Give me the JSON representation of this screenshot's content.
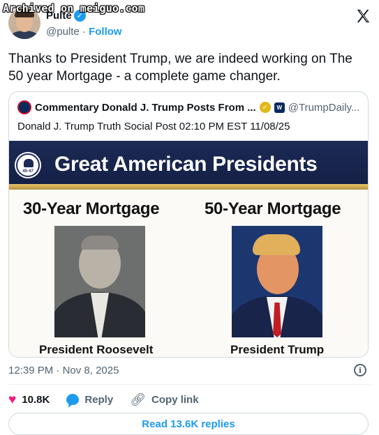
{
  "watermark": "Archived on meiguo.com",
  "author": {
    "name": "Pulte",
    "handle": "@pulte",
    "follow_label": "Follow"
  },
  "tweet_text": "Thanks to President Trump, we are indeed working on The 50 year Mortgage  - a complete game changer.",
  "quote": {
    "name": "Commentary Donald J. Trump Posts From ...",
    "handle": "@TrumpDaily...",
    "affiliate_badge": "W",
    "subtitle": "Donald J. Trump Truth Social Post 02:10 PM EST 11/08/25",
    "image": {
      "seal_text": "45·47",
      "banner_title": "Great American Presidents",
      "left_heading": "30-Year Mortgage",
      "right_heading": "50-Year Mortgage",
      "left_name": "President Roosevelt",
      "right_name": "President Trump"
    }
  },
  "meta": {
    "time": "12:39 PM",
    "separator": " · ",
    "date": "Nov 8, 2025"
  },
  "actions": {
    "likes": "10.8K",
    "reply_label": "Reply",
    "copy_label": "Copy link"
  },
  "read_replies": "Read 13.6K replies",
  "colors": {
    "accent": "#1d9bf0",
    "like": "#f91880",
    "banner": "#1c2a55"
  }
}
